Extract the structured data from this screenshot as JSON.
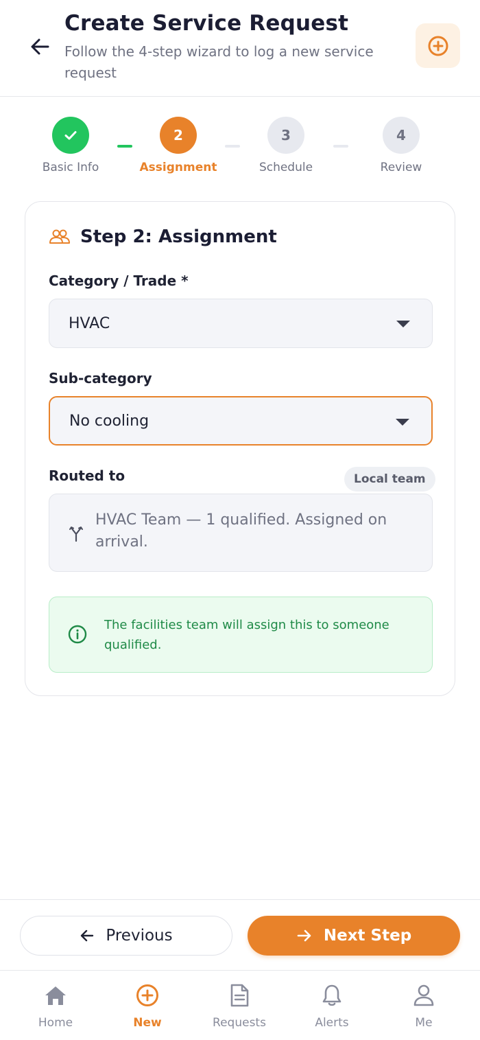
{
  "header": {
    "title": "Create Service Request",
    "subtitle": "Follow the 4-step wizard to log a new service request"
  },
  "stepper": {
    "steps": [
      {
        "number": "1",
        "label": "Basic Info",
        "state": "done"
      },
      {
        "number": "2",
        "label": "Assignment",
        "state": "active"
      },
      {
        "number": "3",
        "label": "Schedule",
        "state": "todo"
      },
      {
        "number": "4",
        "label": "Review",
        "state": "todo"
      }
    ]
  },
  "card": {
    "title": "Step 2: Assignment",
    "category": {
      "label": "Category / Trade *",
      "value": "HVAC"
    },
    "subcategory": {
      "label": "Sub-category",
      "value": "No cooling"
    },
    "routed": {
      "label": "Routed to",
      "badge": "Local team",
      "text": "HVAC Team — 1 qualified. Assigned on arrival."
    },
    "info": "The facilities team will assign this to someone qualified."
  },
  "actions": {
    "previous_label": "Previous",
    "next_label": "Next Step"
  },
  "tabbar": {
    "tabs": [
      {
        "label": "Home",
        "icon": "home-icon"
      },
      {
        "label": "New",
        "icon": "plus-circle-icon",
        "active": true
      },
      {
        "label": "Requests",
        "icon": "document-icon"
      },
      {
        "label": "Alerts",
        "icon": "bell-icon"
      },
      {
        "label": "Me",
        "icon": "user-icon"
      }
    ]
  },
  "colors": {
    "accent": "#e8822a",
    "success": "#22c55e",
    "info_text": "#1f8a47",
    "heading": "#1b1d33"
  }
}
